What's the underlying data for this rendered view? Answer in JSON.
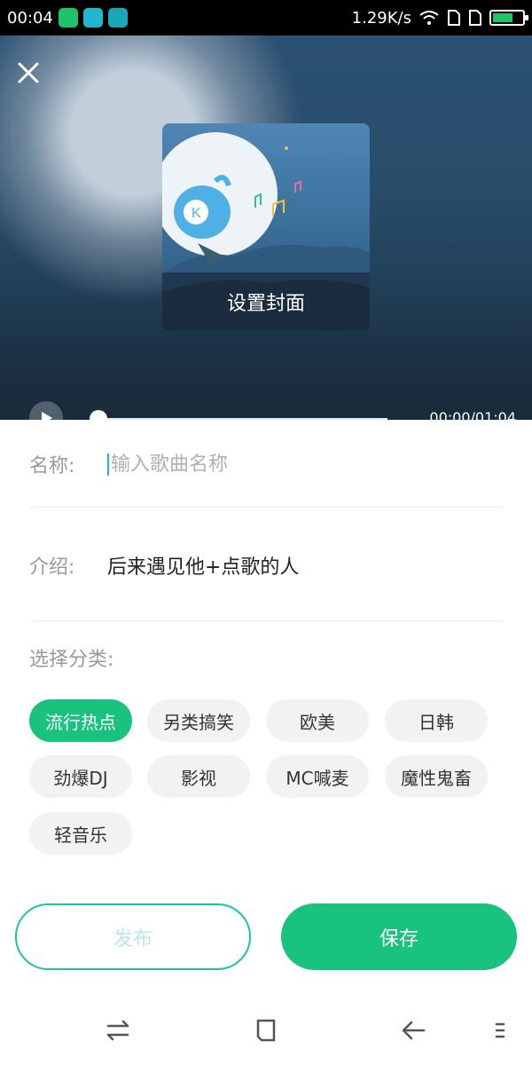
{
  "status_bar": {
    "time": "00:04",
    "network_speed": "1.29K/s",
    "icons": [
      "app-green-icon",
      "app-cyan-icon",
      "usb-icon",
      "wifi-icon",
      "sim-icon",
      "sim-icon",
      "battery-icon"
    ]
  },
  "hero": {
    "cover_label": "设置封面",
    "time": "00:00/01:04",
    "progress": 0
  },
  "form": {
    "name_label": "名称:",
    "name_placeholder": "输入歌曲名称",
    "name_value": "",
    "intro_label": "介绍:",
    "intro_value": "后来遇见他+点歌的人",
    "category_title": "选择分类:",
    "categories": [
      "流行热点",
      "另类搞笑",
      "欧美",
      "日韩",
      "劲爆DJ",
      "影视",
      "MC喊麦",
      "魔性鬼畜",
      "轻音乐"
    ],
    "selected_category": "流行热点"
  },
  "actions": {
    "publish_label": "发布",
    "save_label": "保存"
  },
  "colors": {
    "accent": "#19c37d",
    "outline": "#1fc3a7"
  }
}
